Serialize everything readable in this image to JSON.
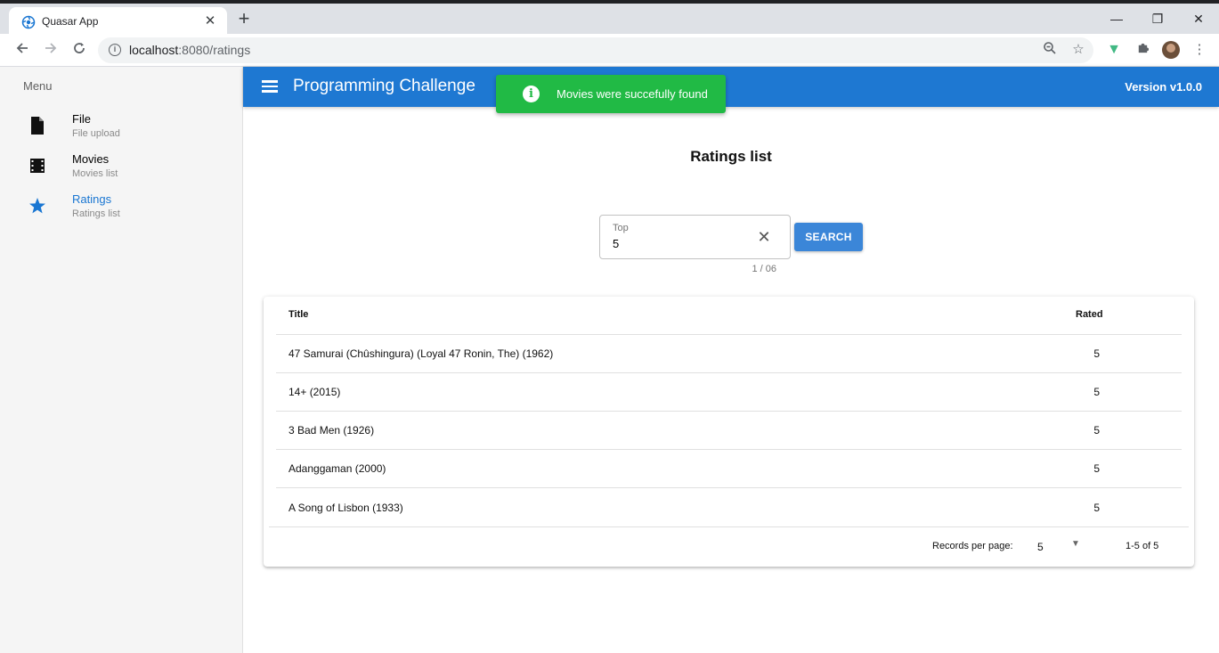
{
  "browser": {
    "tab_title": "Quasar App",
    "tab_close": "✕",
    "new_tab": "+",
    "url_host": "localhost",
    "url_path": ":8080/ratings",
    "win_min": "—",
    "win_restore": "❐",
    "win_close": "✕"
  },
  "drawer": {
    "header": "Menu",
    "items": [
      {
        "label": "File",
        "caption": "File upload",
        "icon": "file-icon"
      },
      {
        "label": "Movies",
        "caption": "Movies list",
        "icon": "movie-icon"
      },
      {
        "label": "Ratings",
        "caption": "Ratings list",
        "icon": "star-icon",
        "active": true
      }
    ]
  },
  "header": {
    "title": "Programming Challenge",
    "version": "Version v1.0.0",
    "color": "#1e78d2"
  },
  "notification": {
    "message": "Movies were succefully found",
    "color": "#21ba45"
  },
  "page": {
    "title": "Ratings list"
  },
  "search": {
    "label": "Top",
    "value": "5",
    "counter": "1 / 06",
    "button": "SEARCH"
  },
  "table": {
    "columns": [
      "Title",
      "Rated"
    ],
    "rows": [
      {
        "title": "47 Samurai (Chûshingura) (Loyal 47 Ronin, The) (1962)",
        "rated": "5"
      },
      {
        "title": "14+ (2015)",
        "rated": "5"
      },
      {
        "title": "3 Bad Men (1926)",
        "rated": "5"
      },
      {
        "title": "Adanggaman (2000)",
        "rated": "5"
      },
      {
        "title": "A Song of Lisbon (1933)",
        "rated": "5"
      }
    ],
    "footer": {
      "records_per_page_label": "Records per page:",
      "records_per_page": "5",
      "range": "1-5 of 5"
    }
  }
}
